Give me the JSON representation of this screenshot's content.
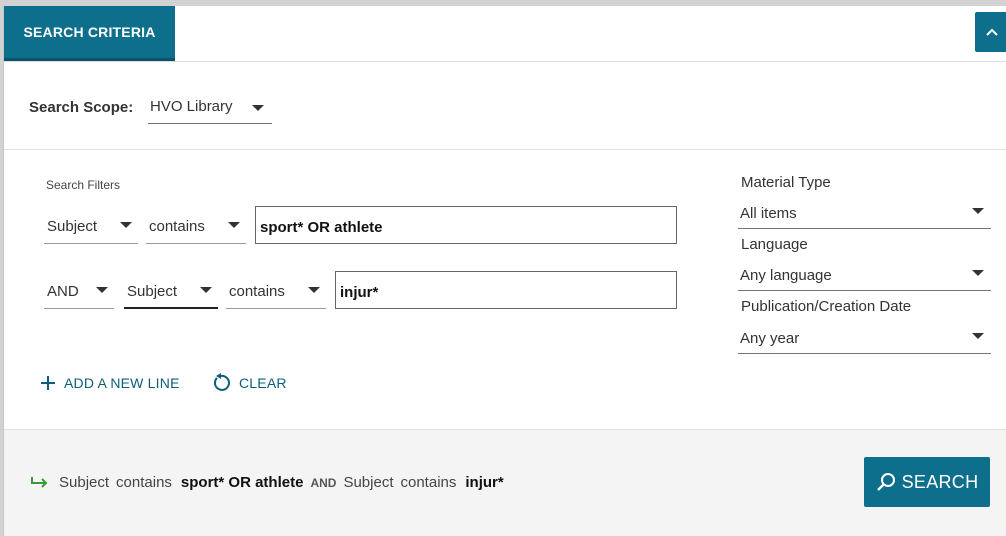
{
  "tabs": {
    "active_label": "SEARCH CRITERIA"
  },
  "scope": {
    "label": "Search Scope:",
    "value": "HVO Library"
  },
  "filters": {
    "title": "Search Filters",
    "rows": [
      {
        "field": "Subject",
        "operator": "contains",
        "value": "sport* OR athlete"
      },
      {
        "boolean": "AND",
        "field": "Subject",
        "operator": "contains",
        "value": "injur*"
      }
    ],
    "add_line_label": "ADD A NEW LINE",
    "clear_label": "CLEAR"
  },
  "facets": {
    "material_type": {
      "label": "Material Type",
      "value": "All items"
    },
    "language": {
      "label": "Language",
      "value": "Any language"
    },
    "date": {
      "label": "Publication/Creation Date",
      "value": "Any year"
    }
  },
  "summary": {
    "field1": "Subject",
    "op1": "contains",
    "value1": "sport* OR athlete",
    "boolean": "AND",
    "field2": "Subject",
    "op2": "contains",
    "value2": "injur*"
  },
  "search_button": {
    "label": "SEARCH"
  },
  "colors": {
    "accent": "#0d6f8c",
    "arrow": "#3a9a3a"
  }
}
